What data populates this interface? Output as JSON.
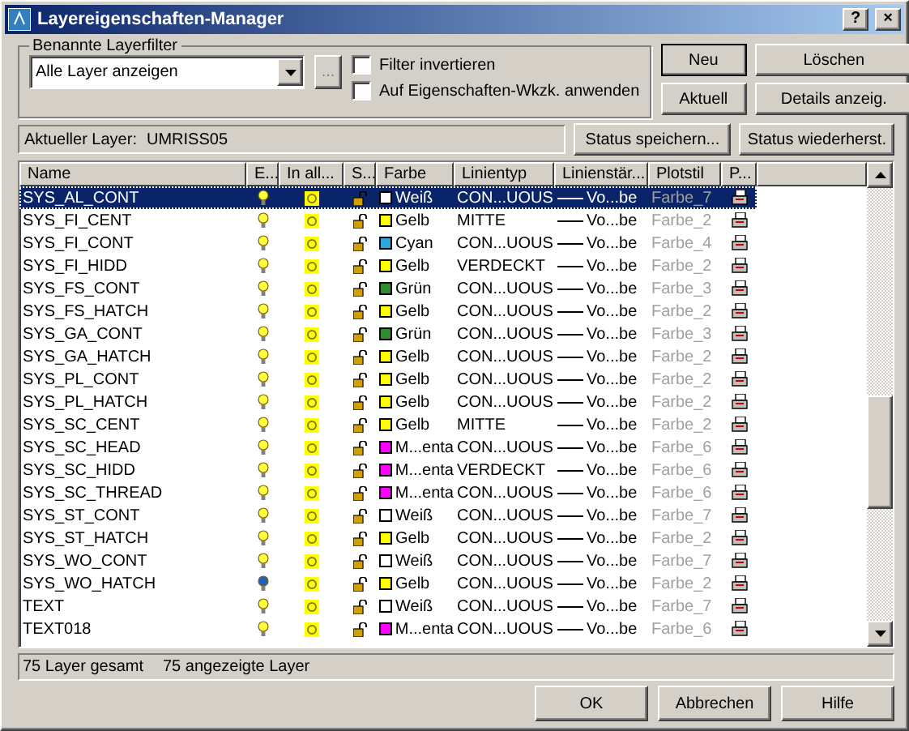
{
  "window": {
    "title": "Layereigenschaften-Manager",
    "buttons": [
      "?",
      "×"
    ]
  },
  "filter_group": {
    "label": "Benannte Layerfilter",
    "value": "Alle Layer anzeigen",
    "browse": "...",
    "options": [
      {
        "label": "Filter invertieren",
        "checked": false
      },
      {
        "label": "Auf Eigenschaften-Wkzk. anwenden",
        "checked": false
      }
    ]
  },
  "side_buttons": [
    {
      "label": "Neu",
      "default": true
    },
    {
      "label": "Löschen",
      "default": false
    },
    {
      "label": "Aktuell",
      "default": false
    },
    {
      "label": "Details anzeig.",
      "default": false
    }
  ],
  "current_layer": {
    "label": "Aktueller Layer:",
    "value": "UMRISS05"
  },
  "state_buttons": [
    "Status speichern...",
    "Status wiederherst."
  ],
  "table": {
    "columns": [
      "Name",
      "E...",
      "In all...",
      "S...",
      "Farbe",
      "Linientyp",
      "Linienstär...",
      "Plotstil",
      "P..."
    ],
    "rows": [
      {
        "name": "SYS_AL_CONT",
        "on": true,
        "color_name": "Weiß",
        "color": "#ffffff",
        "linetype": "CON...UOUS",
        "lineweight": "Vo...be",
        "plotstyle": "Farbe_7",
        "selected": true
      },
      {
        "name": "SYS_FI_CENT",
        "on": true,
        "color_name": "Gelb",
        "color": "#ffff00",
        "linetype": "MITTE",
        "lineweight": "Vo...be",
        "plotstyle": "Farbe_2",
        "selected": false
      },
      {
        "name": "SYS_FI_CONT",
        "on": true,
        "color_name": "Cyan",
        "color": "#29a8e0",
        "linetype": "CON...UOUS",
        "lineweight": "Vo...be",
        "plotstyle": "Farbe_4",
        "selected": false
      },
      {
        "name": "SYS_FI_HIDD",
        "on": true,
        "color_name": "Gelb",
        "color": "#ffff00",
        "linetype": "VERDECKT",
        "lineweight": "Vo...be",
        "plotstyle": "Farbe_2",
        "selected": false
      },
      {
        "name": "SYS_FS_CONT",
        "on": true,
        "color_name": "Grün",
        "color": "#2e8b2e",
        "linetype": "CON...UOUS",
        "lineweight": "Vo...be",
        "plotstyle": "Farbe_3",
        "selected": false
      },
      {
        "name": "SYS_FS_HATCH",
        "on": true,
        "color_name": "Gelb",
        "color": "#ffff00",
        "linetype": "CON...UOUS",
        "lineweight": "Vo...be",
        "plotstyle": "Farbe_2",
        "selected": false
      },
      {
        "name": "SYS_GA_CONT",
        "on": true,
        "color_name": "Grün",
        "color": "#2e8b2e",
        "linetype": "CON...UOUS",
        "lineweight": "Vo...be",
        "plotstyle": "Farbe_3",
        "selected": false
      },
      {
        "name": "SYS_GA_HATCH",
        "on": true,
        "color_name": "Gelb",
        "color": "#ffff00",
        "linetype": "CON...UOUS",
        "lineweight": "Vo...be",
        "plotstyle": "Farbe_2",
        "selected": false
      },
      {
        "name": "SYS_PL_CONT",
        "on": true,
        "color_name": "Gelb",
        "color": "#ffff00",
        "linetype": "CON...UOUS",
        "lineweight": "Vo...be",
        "plotstyle": "Farbe_2",
        "selected": false
      },
      {
        "name": "SYS_PL_HATCH",
        "on": true,
        "color_name": "Gelb",
        "color": "#ffff00",
        "linetype": "CON...UOUS",
        "lineweight": "Vo...be",
        "plotstyle": "Farbe_2",
        "selected": false
      },
      {
        "name": "SYS_SC_CENT",
        "on": true,
        "color_name": "Gelb",
        "color": "#ffff00",
        "linetype": "MITTE",
        "lineweight": "Vo...be",
        "plotstyle": "Farbe_2",
        "selected": false
      },
      {
        "name": "SYS_SC_HEAD",
        "on": true,
        "color_name": "M...enta",
        "color": "#ff00ff",
        "linetype": "CON...UOUS",
        "lineweight": "Vo...be",
        "plotstyle": "Farbe_6",
        "selected": false
      },
      {
        "name": "SYS_SC_HIDD",
        "on": true,
        "color_name": "M...enta",
        "color": "#ff00ff",
        "linetype": "VERDECKT",
        "lineweight": "Vo...be",
        "plotstyle": "Farbe_6",
        "selected": false
      },
      {
        "name": "SYS_SC_THREAD",
        "on": true,
        "color_name": "M...enta",
        "color": "#ff00ff",
        "linetype": "CON...UOUS",
        "lineweight": "Vo...be",
        "plotstyle": "Farbe_6",
        "selected": false
      },
      {
        "name": "SYS_ST_CONT",
        "on": true,
        "color_name": "Weiß",
        "color": "#ffffff",
        "linetype": "CON...UOUS",
        "lineweight": "Vo...be",
        "plotstyle": "Farbe_7",
        "selected": false
      },
      {
        "name": "SYS_ST_HATCH",
        "on": true,
        "color_name": "Gelb",
        "color": "#ffff00",
        "linetype": "CON...UOUS",
        "lineweight": "Vo...be",
        "plotstyle": "Farbe_2",
        "selected": false
      },
      {
        "name": "SYS_WO_CONT",
        "on": true,
        "color_name": "Weiß",
        "color": "#ffffff",
        "linetype": "CON...UOUS",
        "lineweight": "Vo...be",
        "plotstyle": "Farbe_7",
        "selected": false
      },
      {
        "name": "SYS_WO_HATCH",
        "on": false,
        "color_name": "Gelb",
        "color": "#ffff00",
        "linetype": "CON...UOUS",
        "lineweight": "Vo...be",
        "plotstyle": "Farbe_2",
        "selected": false
      },
      {
        "name": "TEXT",
        "on": true,
        "color_name": "Weiß",
        "color": "#ffffff",
        "linetype": "CON...UOUS",
        "lineweight": "Vo...be",
        "plotstyle": "Farbe_7",
        "selected": false
      },
      {
        "name": "TEXT018",
        "on": true,
        "color_name": "M...enta",
        "color": "#ff00ff",
        "linetype": "CON...UOUS",
        "lineweight": "Vo...be",
        "plotstyle": "Farbe_6",
        "selected": false
      }
    ]
  },
  "status_bar": {
    "total": "75 Layer gesamt",
    "shown": "75 angezeigte Layer"
  },
  "footer_buttons": [
    "OK",
    "Abbrechen",
    "Hilfe"
  ]
}
